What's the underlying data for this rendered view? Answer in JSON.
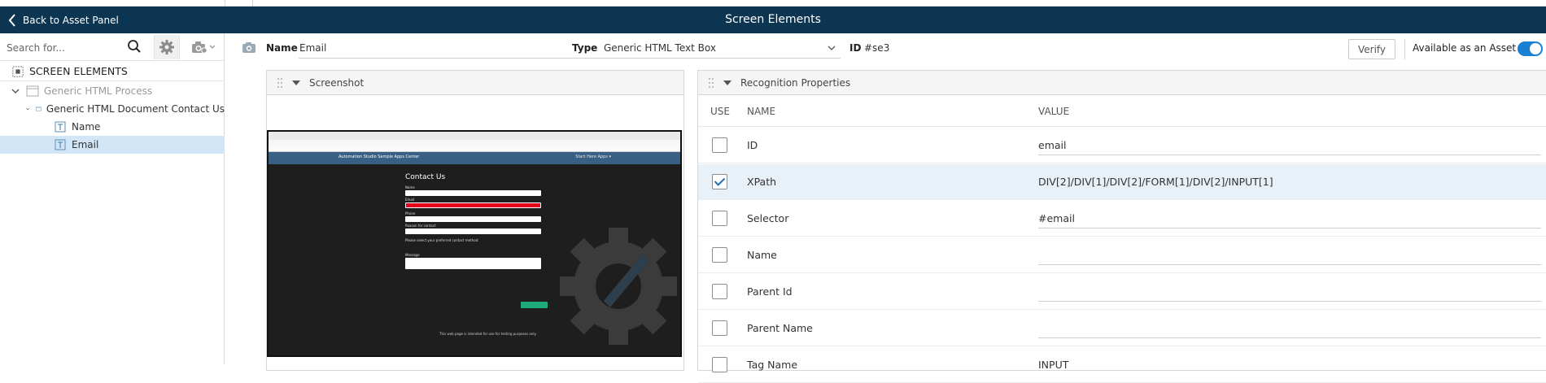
{
  "header": {
    "back_label": "Back to Asset Panel",
    "title": "Screen Elements"
  },
  "sidebar": {
    "search_placeholder": "Search for...",
    "tree": {
      "root_label": "SCREEN ELEMENTS",
      "process_label": "Generic HTML Process",
      "document_label": "Generic HTML Document Contact Us",
      "items": [
        {
          "label": "Name",
          "selected": false
        },
        {
          "label": "Email",
          "selected": true
        }
      ]
    }
  },
  "element": {
    "name_label": "Name",
    "name_value": "Email",
    "type_label": "Type",
    "type_value": "Generic HTML Text Box",
    "id_label": "ID",
    "id_value": "#se3",
    "verify_label": "Verify",
    "available_label": "Available as an Asset",
    "available_on": true
  },
  "screenshot_panel": {
    "title": "Screenshot",
    "thumbnail": {
      "nav_title": "Automation Studio Sample Apps Center",
      "nav_right": "Start Here  Apps ▾",
      "heading": "Contact Us",
      "labels": [
        "Name",
        "Email",
        "Phone",
        "Reason for contact",
        "Please select your preferred contact method:",
        "Message"
      ],
      "footer": "This web page is intended for use for testing purposes only."
    }
  },
  "recognition_panel": {
    "title": "Recognition Properties",
    "columns": {
      "use": "USE",
      "name": "NAME",
      "value": "VALUE"
    },
    "rows": [
      {
        "name": "ID",
        "value": "email",
        "use": false
      },
      {
        "name": "XPath",
        "value": "DIV[2]/DIV[1]/DIV[2]/FORM[1]/DIV[2]/INPUT[1]",
        "use": true
      },
      {
        "name": "Selector",
        "value": "#email",
        "use": false
      },
      {
        "name": "Name",
        "value": "",
        "use": false
      },
      {
        "name": "Parent Id",
        "value": "",
        "use": false
      },
      {
        "name": "Parent Name",
        "value": "",
        "use": false
      },
      {
        "name": "Tag Name",
        "value": "INPUT",
        "use": false
      }
    ]
  },
  "colors": {
    "title_bar": "#0c3551",
    "selection": "#d3e6f7",
    "toggle_on": "#1a7fd1"
  }
}
